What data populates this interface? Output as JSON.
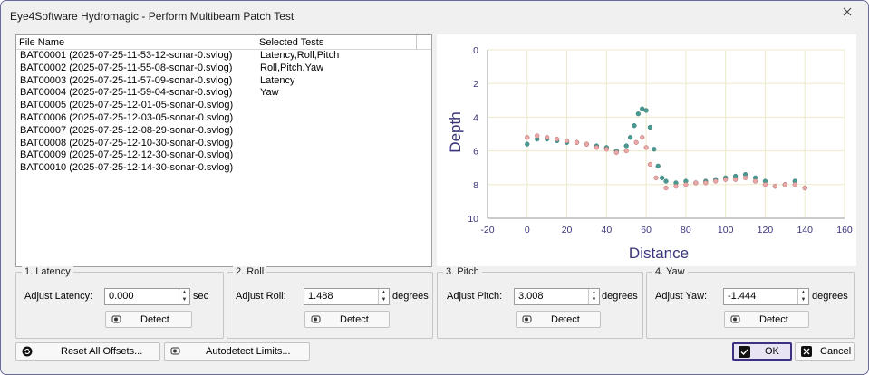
{
  "window": {
    "title": "Eye4Software Hydromagic - Perform Multibeam Patch Test"
  },
  "file_list": {
    "columns": [
      "File Name",
      "Selected Tests"
    ],
    "rows": [
      {
        "file": "BAT00001 (2025-07-25-11-53-12-sonar-0.svlog)",
        "tests": "Latency,Roll,Pitch"
      },
      {
        "file": "BAT00002 (2025-07-25-11-55-08-sonar-0.svlog)",
        "tests": "Roll,Pitch,Yaw"
      },
      {
        "file": "BAT00003 (2025-07-25-11-57-09-sonar-0.svlog)",
        "tests": "Latency"
      },
      {
        "file": "BAT00004 (2025-07-25-11-59-04-sonar-0.svlog)",
        "tests": "Yaw"
      },
      {
        "file": "BAT00005 (2025-07-25-12-01-05-sonar-0.svlog)",
        "tests": ""
      },
      {
        "file": "BAT00006 (2025-07-25-12-03-05-sonar-0.svlog)",
        "tests": ""
      },
      {
        "file": "BAT00007 (2025-07-25-12-08-29-sonar-0.svlog)",
        "tests": ""
      },
      {
        "file": "BAT00008 (2025-07-25-12-10-30-sonar-0.svlog)",
        "tests": ""
      },
      {
        "file": "BAT00009 (2025-07-25-12-12-30-sonar-0.svlog)",
        "tests": ""
      },
      {
        "file": "BAT00010 (2025-07-25-12-14-30-sonar-0.svlog)",
        "tests": ""
      }
    ]
  },
  "chart": {
    "xlabel": "Distance",
    "ylabel": "Depth",
    "xticks": [
      "-20",
      "0",
      "20",
      "40",
      "60",
      "80",
      "100",
      "120",
      "140",
      "160"
    ],
    "yticks": [
      "0",
      "2",
      "4",
      "6",
      "8",
      "10"
    ],
    "xlim": [
      -20,
      160
    ],
    "ylim": [
      0,
      10
    ],
    "series_colors": [
      "#4a9a94",
      "#e8a8a8"
    ]
  },
  "chart_data": {
    "type": "scatter",
    "xlabel": "Distance",
    "ylabel": "Depth",
    "xlim": [
      -20,
      160
    ],
    "ylim": [
      0,
      10
    ],
    "y_inverted": true,
    "grid": true,
    "series": [
      {
        "color": "#4a9a94",
        "x": [
          0,
          5,
          10,
          15,
          20,
          25,
          30,
          35,
          40,
          45,
          50,
          52,
          54,
          56,
          58,
          60,
          62,
          64,
          66,
          68,
          70,
          75,
          80,
          85,
          90,
          95,
          100,
          105,
          110,
          115,
          120,
          125,
          130,
          135,
          140
        ],
        "y": [
          5.6,
          5.3,
          5.3,
          5.4,
          5.5,
          5.5,
          5.6,
          5.7,
          5.8,
          6.0,
          5.7,
          5.2,
          4.5,
          3.8,
          3.5,
          3.6,
          4.6,
          5.9,
          6.9,
          7.6,
          7.8,
          7.9,
          7.8,
          7.9,
          7.8,
          7.7,
          7.6,
          7.5,
          7.4,
          7.6,
          7.8,
          8.1,
          8.0,
          7.8,
          8.2
        ]
      },
      {
        "color": "#e8a8a8",
        "x": [
          0,
          5,
          10,
          15,
          20,
          25,
          30,
          35,
          40,
          45,
          50,
          55,
          58,
          60,
          62,
          65,
          70,
          75,
          80,
          85,
          90,
          95,
          100,
          105,
          110,
          115,
          120,
          125,
          130,
          135,
          140
        ],
        "y": [
          5.2,
          5.1,
          5.2,
          5.3,
          5.4,
          5.5,
          5.6,
          5.8,
          5.9,
          6.1,
          6.0,
          5.5,
          5.2,
          5.8,
          6.8,
          7.6,
          8.2,
          8.1,
          8.0,
          7.9,
          7.9,
          7.8,
          7.7,
          7.7,
          7.6,
          7.8,
          8.0,
          8.1,
          8.0,
          8.0,
          8.2
        ]
      }
    ]
  },
  "latency": {
    "legend": "1. Latency",
    "label": "Adjust Latency:",
    "value": "0.000",
    "unit": "sec",
    "detect": "Detect"
  },
  "roll": {
    "legend": "2. Roll",
    "label": "Adjust Roll:",
    "value": "1.488",
    "unit": "degrees",
    "detect": "Detect"
  },
  "pitch": {
    "legend": "3. Pitch",
    "label": "Adjust Pitch:",
    "value": "3.008",
    "unit": "degrees",
    "detect": "Detect"
  },
  "yaw": {
    "legend": "4. Yaw",
    "label": "Adjust Yaw:",
    "value": "-1.444",
    "unit": "degrees",
    "detect": "Detect"
  },
  "footer": {
    "reset": "Reset All Offsets...",
    "autodetect": "Autodetect Limits...",
    "ok": "OK",
    "cancel": "Cancel"
  }
}
